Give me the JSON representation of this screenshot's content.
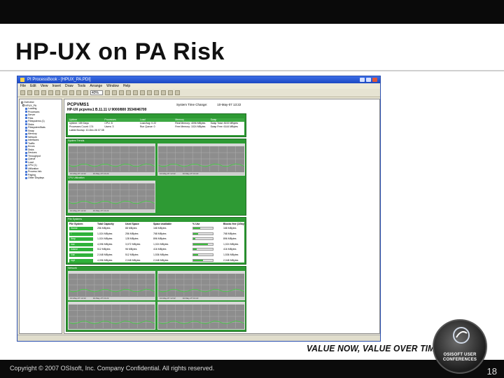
{
  "slide": {
    "title": "HP-UX on PA Risk",
    "slogan": "VALUE NOW, VALUE OVER TIME",
    "badge_line1": "OSISOFT USER",
    "badge_line2": "CONFERENCES",
    "copyright": "Copyright © 2007 OSIsoft, Inc. Company Confidential. All rights reserved.",
    "page_number": "18"
  },
  "window": {
    "title": "PI ProcessBook - [HPUX_PA.PDI]",
    "menu": [
      "File",
      "Edit",
      "View",
      "Insert",
      "Draw",
      "Tools",
      "Arrange",
      "Window",
      "Help"
    ],
    "zoom": "40%"
  },
  "tree": {
    "items": [
      "Overview",
      "HPUX_PA",
      "Loading",
      "Processes",
      "Server",
      "Files",
      "Filesystems (1)",
      "Disks",
      "FilesystemStats",
      "Swap",
      "Memory",
      "Network",
      "Interfaces",
      "Traffic",
      "Errors",
      "Disks",
      "Devices",
      "Throughput",
      "Queue",
      "Load",
      "CPU (1)",
      "Utilization",
      "Process Info",
      "Paging",
      "Other Displays"
    ]
  },
  "display": {
    "host": "PCPVMS1",
    "time_label": "System Time Change:",
    "time_value": "10-May-07 13:22",
    "subtitle": "HP-UX pcpvms1 B.11.11 U 9000/800 3534046700"
  },
  "status": {
    "headers": [
      "Uptime",
      "Processes",
      "Load",
      "Memory",
      "Swap"
    ],
    "row1": [
      "Uptime: 159 Days",
      "CPU: 8",
      "Load Avg: 0.22",
      "Real Memory: 4096 MBytes",
      "Swap Total: 8192 MBytes"
    ],
    "row2": [
      "Processes Count: 174",
      "Users: 3",
      "Run Queue: 0",
      "Free Memory: 1024 MBytes",
      "Swap Free: 6144 MBytes"
    ],
    "last_boot_label": "Latest Bootup:",
    "last_boot_value": "10-Dec-06 07:38"
  },
  "panels": {
    "system_trends": "System Trends",
    "cpu_utilization": "CPU Utilization",
    "file_systems": "File Systems",
    "network": "Network"
  },
  "filesystems": {
    "headers": [
      "File System",
      "Total Capacity",
      "Used Space",
      "Space available",
      "% Use",
      "Blocks free (1Gbytes)"
    ],
    "rows": [
      {
        "name": "/home",
        "total": "256 MBytes",
        "used": "88 MBytes",
        "avail": "168 MBytes",
        "pct": 34,
        "free": "168 MBytes"
      },
      {
        "name": "/",
        "total": "1,024 MBytes",
        "used": "256 MBytes",
        "avail": "768 MBytes",
        "pct": 25,
        "free": "768 MBytes"
      },
      {
        "name": "/tmp",
        "total": "1,024 MBytes",
        "used": "128 MBytes",
        "avail": "896 MBytes",
        "pct": 12,
        "free": "896 MBytes"
      },
      {
        "name": "/usr",
        "total": "4,096 MBytes",
        "used": "3,072 MBytes",
        "avail": "1,024 MBytes",
        "pct": 75,
        "free": "1,024 MBytes"
      },
      {
        "name": "/stand",
        "total": "512 MBytes",
        "used": "96 MBytes",
        "avail": "416 MBytes",
        "pct": 19,
        "free": "416 MBytes"
      },
      {
        "name": "/var",
        "total": "2,048 MBytes",
        "used": "512 MBytes",
        "avail": "1,536 MBytes",
        "pct": 25,
        "free": "1,536 MBytes"
      },
      {
        "name": "/opt",
        "total": "4,096 MBytes",
        "used": "2,048 MBytes",
        "avail": "2,048 MBytes",
        "pct": 50,
        "free": "2,048 MBytes"
      }
    ]
  },
  "charts": {
    "foot_start": "10-May-07 12:22",
    "foot_end": "10-May-07 13:22"
  },
  "colors": {
    "panel_green": "#2e9a34",
    "chart_gray": "#8d8d8d",
    "title_blue": "#1c48c2"
  }
}
